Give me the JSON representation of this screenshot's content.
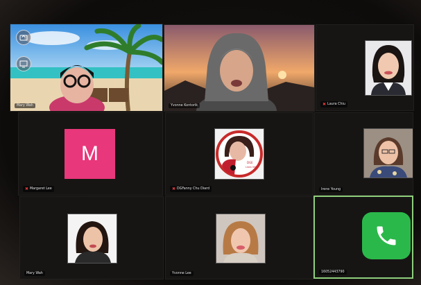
{
  "participants": [
    {
      "name": "Mary Wah",
      "muted": false
    },
    {
      "name": "Yvonne Kontorik",
      "muted": false
    },
    {
      "name": "Laura Chiu",
      "muted": true
    },
    {
      "name": "Margaret Lee",
      "muted": true,
      "avatar_letter": "M",
      "avatar_color": "#e8377a"
    },
    {
      "name": "DGFanny Chu Diard",
      "muted": true,
      "badge_text": "Fanny Chu Diard, DGE Lions Int'l"
    },
    {
      "name": "Irene Young",
      "muted": false
    },
    {
      "name": "Mary Wah",
      "muted": false
    },
    {
      "name": "Yvonne Lee",
      "muted": false
    },
    {
      "name": "16052443790",
      "muted": false,
      "phone_icon_color": "#2bb84a"
    }
  ],
  "colors": {
    "active_speaker_border": "#8fcf7c",
    "mute_icon": "#e0393e"
  }
}
